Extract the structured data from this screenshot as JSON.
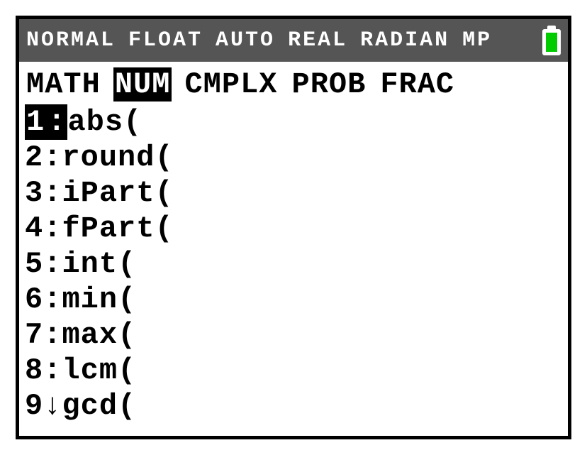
{
  "status": {
    "items": [
      "NORMAL",
      "FLOAT",
      "AUTO",
      "REAL",
      "RADIAN",
      "MP"
    ]
  },
  "tabs": [
    {
      "label": "MATH",
      "active": false
    },
    {
      "label": "NUM",
      "active": true
    },
    {
      "label": "CMPLX",
      "active": false
    },
    {
      "label": "PROB",
      "active": false
    },
    {
      "label": "FRAC",
      "active": false
    }
  ],
  "menu": [
    {
      "num": "1",
      "sep": ":",
      "label": "abs(",
      "selected": true,
      "arrow": ""
    },
    {
      "num": "2",
      "sep": ":",
      "label": "round(",
      "selected": false,
      "arrow": ""
    },
    {
      "num": "3",
      "sep": ":",
      "label": "iPart(",
      "selected": false,
      "arrow": ""
    },
    {
      "num": "4",
      "sep": ":",
      "label": "fPart(",
      "selected": false,
      "arrow": ""
    },
    {
      "num": "5",
      "sep": ":",
      "label": "int(",
      "selected": false,
      "arrow": ""
    },
    {
      "num": "6",
      "sep": ":",
      "label": "min(",
      "selected": false,
      "arrow": ""
    },
    {
      "num": "7",
      "sep": ":",
      "label": "max(",
      "selected": false,
      "arrow": ""
    },
    {
      "num": "8",
      "sep": ":",
      "label": "lcm(",
      "selected": false,
      "arrow": ""
    },
    {
      "num": "9",
      "sep": "",
      "label": "gcd(",
      "selected": false,
      "arrow": "↓"
    }
  ]
}
